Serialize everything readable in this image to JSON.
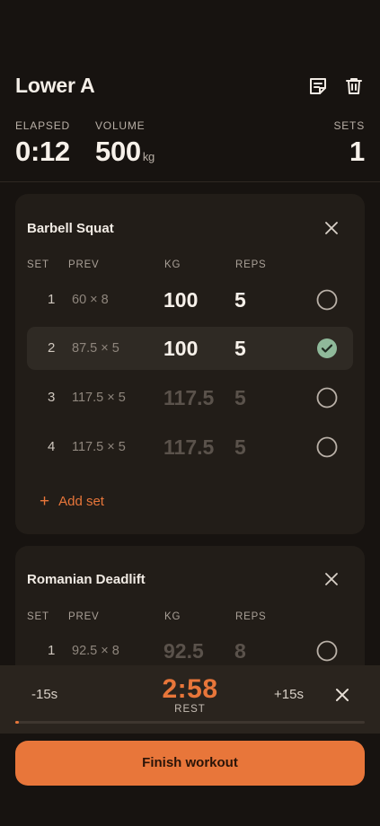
{
  "workout": {
    "title": "Lower A",
    "notes_icon": "note-icon",
    "delete_icon": "trash-icon"
  },
  "stats": {
    "elapsed_label": "ELAPSED",
    "elapsed_value": "0:12",
    "volume_label": "VOLUME",
    "volume_value": "500",
    "volume_unit": "kg",
    "sets_label": "SETS",
    "sets_value": "1"
  },
  "columns": {
    "set": "SET",
    "prev": "PREV",
    "kg": "KG",
    "reps": "REPS"
  },
  "exercises": [
    {
      "name": "Barbell Squat",
      "sets": [
        {
          "set": "1",
          "prev": "60 × 8",
          "kg": "100",
          "reps": "5",
          "completed": false,
          "placeholder": false
        },
        {
          "set": "2",
          "prev": "87.5 × 5",
          "kg": "100",
          "reps": "5",
          "completed": true,
          "placeholder": false
        },
        {
          "set": "3",
          "prev": "117.5 × 5",
          "kg": "117.5",
          "reps": "5",
          "completed": false,
          "placeholder": true
        },
        {
          "set": "4",
          "prev": "117.5 × 5",
          "kg": "117.5",
          "reps": "5",
          "completed": false,
          "placeholder": true
        }
      ],
      "add_set_label": "Add set"
    },
    {
      "name": "Romanian Deadlift",
      "sets": [
        {
          "set": "1",
          "prev": "92.5 × 8",
          "kg": "92.5",
          "reps": "8",
          "completed": false,
          "placeholder": true
        }
      ]
    }
  ],
  "rest_timer": {
    "minus_label": "-15s",
    "plus_label": "+15s",
    "value": "2:58",
    "label": "REST",
    "progress_fraction": 0.01
  },
  "finish_label": "Finish workout",
  "colors": {
    "accent": "#e8763a",
    "completed_check": "#8fb99a",
    "background": "#171310",
    "card": "#221d18"
  }
}
